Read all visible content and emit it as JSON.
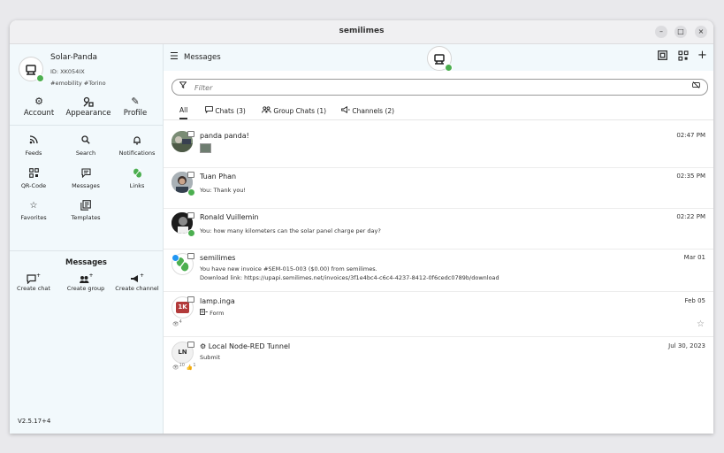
{
  "window": {
    "title": "semilimes"
  },
  "window_controls": {
    "minimize": "–",
    "maximize": "□",
    "close": "×"
  },
  "profile": {
    "name": "Solar-Panda",
    "id": "ID: XK054IX",
    "tags": "#emobility #Torino"
  },
  "top_actions": [
    {
      "label": "Account",
      "icon": "gear-icon"
    },
    {
      "label": "Appearance",
      "icon": "palette-icon"
    },
    {
      "label": "Profile",
      "icon": "pencil-icon"
    }
  ],
  "nav": [
    {
      "label": "Feeds",
      "icon": "rss-icon"
    },
    {
      "label": "Search",
      "icon": "search-icon"
    },
    {
      "label": "Notifications",
      "icon": "bell-icon"
    },
    {
      "label": "QR-Code",
      "icon": "qr-icon"
    },
    {
      "label": "Messages",
      "icon": "message-icon"
    },
    {
      "label": "Links",
      "icon": "leaf-icon"
    },
    {
      "label": "Favorites",
      "icon": "star-icon"
    },
    {
      "label": "Templates",
      "icon": "templates-icon"
    }
  ],
  "messages_section": {
    "title": "Messages",
    "create": [
      {
        "label": "Create chat",
        "icon": "chat-plus-icon"
      },
      {
        "label": "Create group",
        "icon": "group-plus-icon"
      },
      {
        "label": "Create channel",
        "icon": "megaphone-plus-icon"
      }
    ]
  },
  "version": "V2.5.17+4",
  "header": {
    "title": "Messages"
  },
  "search": {
    "placeholder": "Filter"
  },
  "tabs": [
    {
      "label": "All",
      "active": true
    },
    {
      "label": "Chats (3)",
      "icon": "chat-icon"
    },
    {
      "label": "Group Chats (1)",
      "icon": "group-icon"
    },
    {
      "label": "Channels (2)",
      "icon": "megaphone-icon"
    }
  ],
  "chats": [
    {
      "name": "panda panda!",
      "time": "02:47 PM",
      "preview": ""
    },
    {
      "name": "Tuan Phan",
      "time": "02:35 PM",
      "preview": "You: Thank you!"
    },
    {
      "name": "Ronald Vuillemin",
      "time": "02:22 PM",
      "preview": "You: how many kilometers can the solar panel charge per day?"
    },
    {
      "name": "semilimes",
      "time": "Mar 01",
      "preview": "You have new invoice #SEM-015-003 ($0.00) from semilimes.",
      "preview2": "Download link: https://upapi.semilimes.net/invoices/3f1e4bc4-c6c4-4237-8412-0f6cedc0789b/download"
    },
    {
      "name": "lamp.inga",
      "time": "Feb 05",
      "preview": "Form",
      "avatar_text": "1K",
      "views": "4"
    },
    {
      "name": "Local Node-RED Tunnel",
      "time": "Jul 30, 2023",
      "preview": "Submit",
      "avatar_text": "LN",
      "views": "10",
      "likes": "1"
    }
  ],
  "colors": {
    "accent_green": "#4caf50",
    "sidebar_bg": "#f2f9fc",
    "lamp_red": "#b23a3a"
  }
}
